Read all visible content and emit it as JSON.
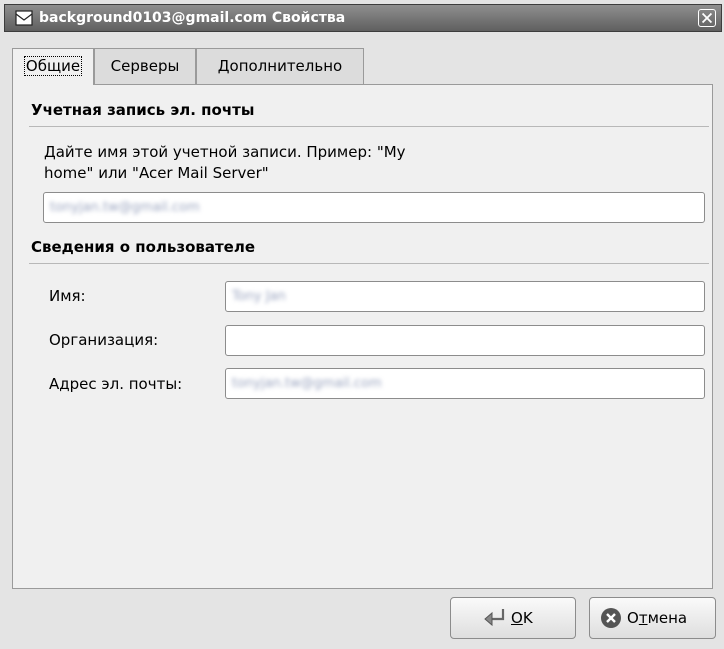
{
  "window": {
    "title": "background0103@gmail.com Свойства"
  },
  "tabs": [
    {
      "label": "Общие",
      "active": true
    },
    {
      "label": "Серверы",
      "active": false
    },
    {
      "label": "Дополнительно",
      "active": false
    }
  ],
  "account_section": {
    "title": "Учетная запись эл. почты",
    "hint_line1": "Дайте имя этой учетной записи. Пример: \"My",
    "hint_line2": "home\" или \"Acer Mail Server\"",
    "name_value": "tonyjan.tw@gmail.com"
  },
  "user_section": {
    "title": "Сведения о пользователе",
    "name_label": "Имя:",
    "name_value": "Tony Jan",
    "org_label": "Организация:",
    "org_value": "",
    "email_label": "Адрес эл. почты:",
    "email_value": "tonyjan.tw@gmail.com"
  },
  "buttons": {
    "ok_mnemonic": "O",
    "ok_rest": "K",
    "cancel_pre": "О",
    "cancel_mnemonic": "т",
    "cancel_rest": "мена"
  },
  "colors": {
    "titlebar": "#6f6f6f",
    "window_bg": "#e4e4e4",
    "panel_bg": "#f0f0f0",
    "cancel_icon": "#555555"
  },
  "icons": {
    "title": "mail-envelope-icon",
    "close": "close-icon",
    "ok": "enter-arrow-icon",
    "cancel": "cancel-circle-icon"
  }
}
